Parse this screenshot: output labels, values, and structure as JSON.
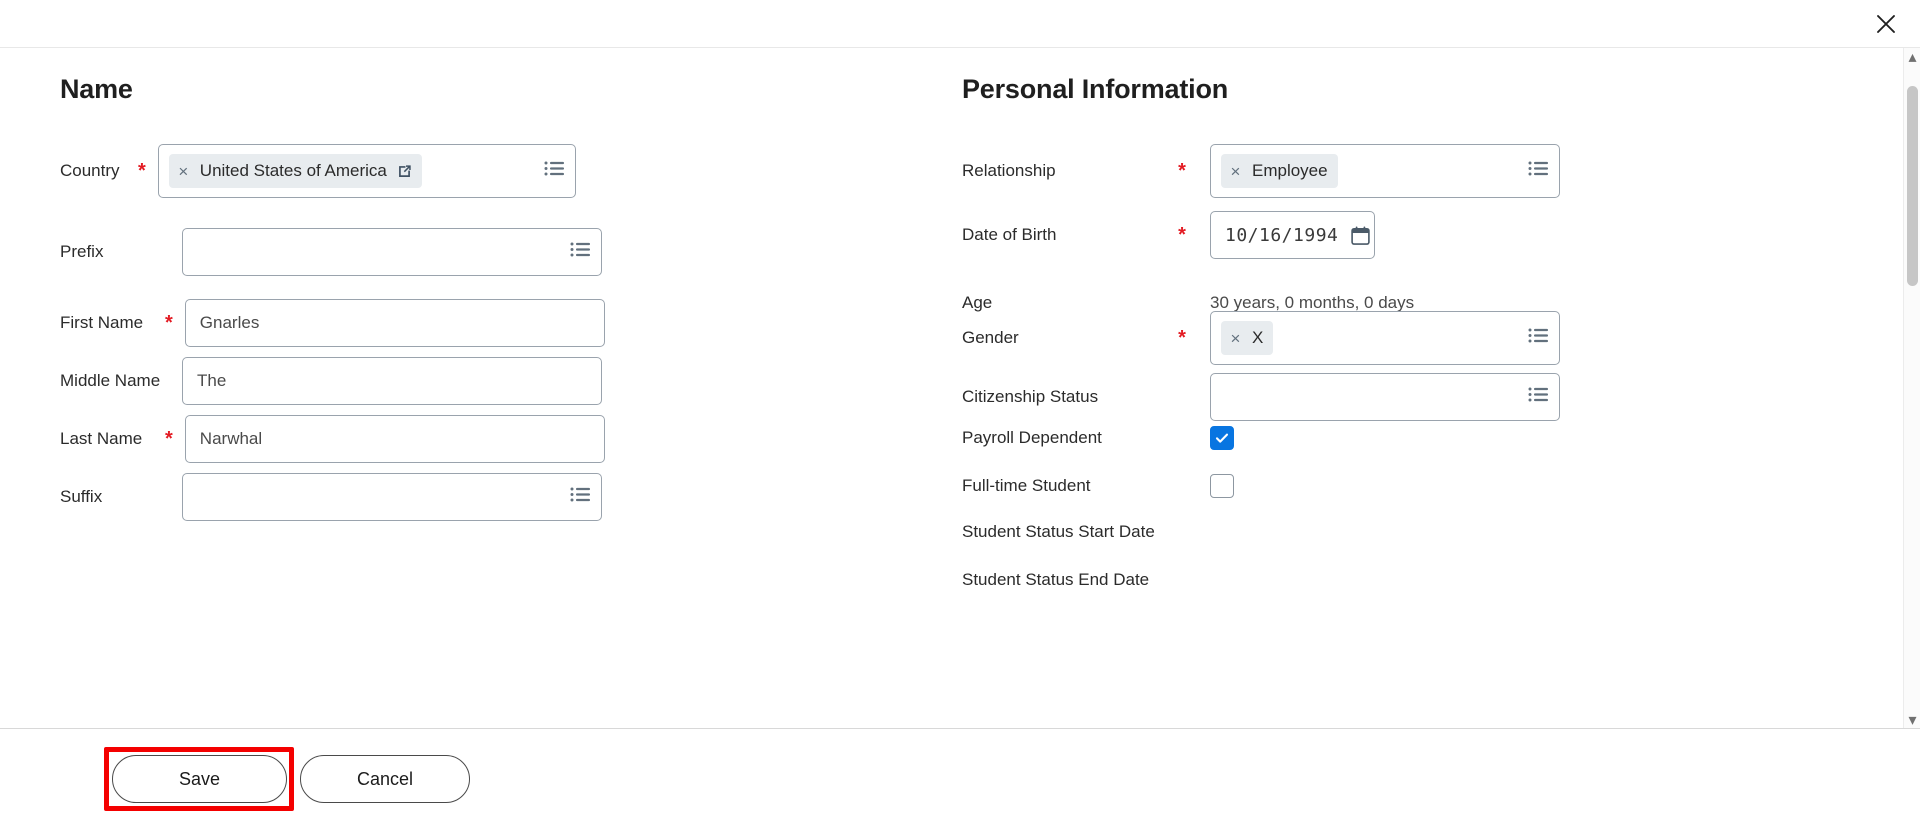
{
  "dialog": {
    "close_label": "Close",
    "close_icon": "close-icon"
  },
  "sections": {
    "name": {
      "title": "Name",
      "fields": {
        "country": {
          "label": "Country",
          "required": "*",
          "value": "United States of America",
          "remove_glyph": "×",
          "external_link_icon": "external-link-icon",
          "prompt_icon": "list-prompt-icon"
        },
        "prefix": {
          "label": "Prefix",
          "value": "",
          "placeholder": "",
          "prompt_icon": "list-prompt-icon"
        },
        "first_name": {
          "label": "First Name",
          "required": "*",
          "value": "Gnarles"
        },
        "middle_name": {
          "label": "Middle Name",
          "value": "The"
        },
        "last_name": {
          "label": "Last Name",
          "required": "*",
          "value": "Narwhal"
        },
        "suffix": {
          "label": "Suffix",
          "value": "",
          "placeholder": "",
          "prompt_icon": "list-prompt-icon"
        }
      }
    },
    "personal_information": {
      "title": "Personal Information",
      "fields": {
        "relationship": {
          "label": "Relationship",
          "required": "*",
          "value": "Employee",
          "remove_glyph": "×",
          "prompt_icon": "list-prompt-icon"
        },
        "date_of_birth": {
          "label": "Date of Birth",
          "required": "*",
          "value": "10/16/1994",
          "calendar_icon": "calendar-icon"
        },
        "age": {
          "label": "Age",
          "value": "30 years, 0 months, 0 days"
        },
        "gender": {
          "label": "Gender",
          "required": "*",
          "value": "X",
          "remove_glyph": "×",
          "prompt_icon": "list-prompt-icon"
        },
        "citizenship_status": {
          "label": "Citizenship Status",
          "value": "",
          "placeholder": "",
          "prompt_icon": "list-prompt-icon"
        },
        "payroll_dependent": {
          "label": "Payroll Dependent",
          "checked": true
        },
        "full_time_student": {
          "label": "Full-time Student",
          "checked": false
        },
        "student_status_start_date": {
          "label": "Student Status Start Date"
        },
        "student_status_end_date": {
          "label": "Student Status End Date"
        }
      }
    }
  },
  "footer": {
    "save_label": "Save",
    "cancel_label": "Cancel"
  },
  "scrollbar": {
    "up_glyph": "▴",
    "down_glyph": "▾"
  },
  "colors": {
    "required_red": "#e31b23",
    "checkbox_blue": "#0875e1",
    "highlight_red": "#f40000",
    "pill_bg": "#e8ecef"
  }
}
